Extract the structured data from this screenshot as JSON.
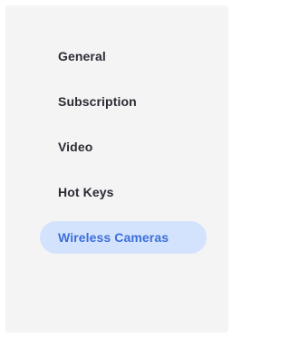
{
  "sidebar": {
    "items": [
      {
        "label": "General",
        "active": false
      },
      {
        "label": "Subscription",
        "active": false
      },
      {
        "label": "Video",
        "active": false
      },
      {
        "label": "Hot Keys",
        "active": false
      },
      {
        "label": "Wireless Cameras",
        "active": true
      }
    ]
  },
  "colors": {
    "sidebar_background": "#f4f4f5",
    "active_background": "#d3e3fd",
    "active_text": "#3d6fd8",
    "text": "#2b2b33"
  }
}
